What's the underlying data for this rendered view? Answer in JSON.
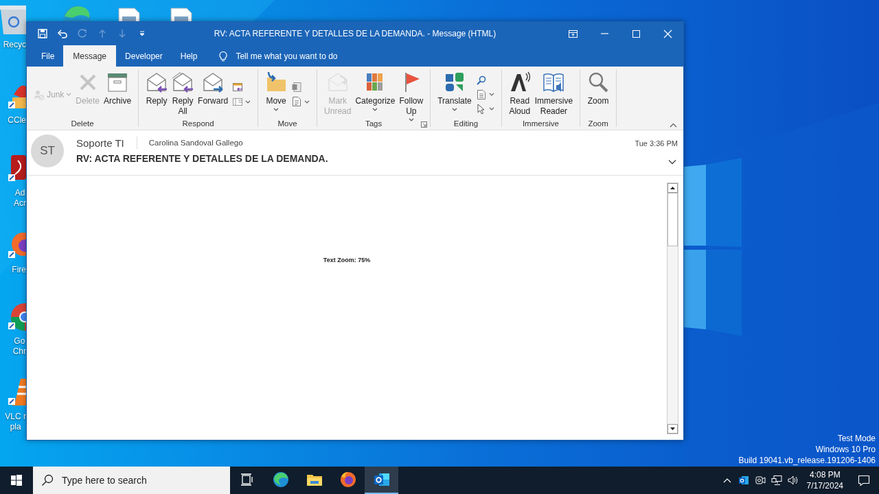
{
  "desktop": {
    "icons": [
      {
        "label": "Recyc"
      },
      {
        "label": "CCle"
      },
      {
        "label": "Ad\nAcr"
      },
      {
        "label": "Fire"
      },
      {
        "label": "Go\nChr"
      },
      {
        "label": "VLC r\npla"
      }
    ],
    "system_notice": [
      "Test Mode",
      "Windows 10 Pro",
      "Build 19041.vb_release.191206-1406"
    ]
  },
  "window": {
    "title": "RV: ACTA REFERENTE Y DETALLES DE LA DEMANDA.  -  Message (HTML)",
    "quick_access": [
      {
        "disabled": false
      },
      {
        "disabled": false
      },
      {
        "disabled": true
      },
      {
        "disabled": true
      },
      {
        "disabled": true
      },
      {
        "disabled": false
      }
    ],
    "tabs": [
      {
        "label": "File",
        "selected": false
      },
      {
        "label": "Message",
        "selected": true
      },
      {
        "label": "Developer",
        "selected": false
      },
      {
        "label": "Help",
        "selected": false
      }
    ],
    "tell_me": "Tell me what you want to do",
    "ribbon": {
      "groups": [
        {
          "label": "Delete",
          "launcher": false,
          "buttons": [
            {
              "kind": "small",
              "label": "Junk",
              "disabled": true,
              "dropdown": true
            },
            {
              "kind": "large",
              "label": "Delete",
              "disabled": true,
              "dropdown": false
            },
            {
              "kind": "large",
              "label": "Archive",
              "disabled": false,
              "dropdown": false
            }
          ]
        },
        {
          "label": "Respond",
          "launcher": false,
          "buttons": [
            {
              "kind": "large",
              "label": "Reply",
              "disabled": false,
              "dropdown": false
            },
            {
              "kind": "large",
              "label": "Reply\nAll",
              "disabled": false,
              "dropdown": false
            },
            {
              "kind": "large",
              "label": "Forward",
              "disabled": false,
              "dropdown": false
            },
            {
              "kind": "small",
              "disabled": false,
              "dropdown": false
            },
            {
              "kind": "small",
              "disabled": false,
              "dropdown": true
            }
          ]
        },
        {
          "label": "Move",
          "launcher": false,
          "buttons": [
            {
              "kind": "large",
              "label": "Move",
              "disabled": false,
              "dropdown": true
            },
            {
              "kind": "small",
              "disabled": false,
              "dropdown": false
            },
            {
              "kind": "small",
              "disabled": false,
              "dropdown": true
            }
          ]
        },
        {
          "label": "Tags",
          "launcher": true,
          "buttons": [
            {
              "kind": "large",
              "label": "Mark\nUnread",
              "disabled": true,
              "dropdown": false
            },
            {
              "kind": "large",
              "label": "Categorize",
              "disabled": false,
              "dropdown": true
            },
            {
              "kind": "large",
              "label": "Follow\nUp",
              "disabled": false,
              "dropdown": true
            }
          ]
        },
        {
          "label": "Editing",
          "launcher": false,
          "buttons": [
            {
              "kind": "large",
              "label": "Translate",
              "disabled": false,
              "dropdown": true
            },
            {
              "kind": "small",
              "disabled": false,
              "dropdown": false
            },
            {
              "kind": "small",
              "disabled": false,
              "dropdown": true
            },
            {
              "kind": "small",
              "disabled": false,
              "dropdown": true
            }
          ]
        },
        {
          "label": "Immersive",
          "launcher": false,
          "buttons": [
            {
              "kind": "large",
              "label": "Read\nAloud",
              "disabled": false,
              "dropdown": false
            },
            {
              "kind": "large",
              "label": "Immersive\nReader",
              "disabled": false,
              "dropdown": false
            }
          ]
        },
        {
          "label": "Zoom",
          "launcher": false,
          "buttons": [
            {
              "kind": "large",
              "label": "Zoom",
              "disabled": false,
              "dropdown": false
            }
          ]
        }
      ]
    },
    "message": {
      "avatar": "ST",
      "sender": "Soporte TI",
      "recipient": "Carolina Sandoval Gallego",
      "time": "Tue 3:36 PM",
      "subject": "RV: ACTA REFERENTE Y DETALLES DE LA DEMANDA."
    },
    "body": {
      "text": "Text Zoom: 75%"
    }
  },
  "taskbar": {
    "search": {
      "placeholder": "Type here to search"
    },
    "apps": [
      {
        "selected": false
      },
      {
        "selected": false
      },
      {
        "selected": false
      },
      {
        "selected": false
      },
      {
        "selected": true
      }
    ],
    "time": "4:08 PM",
    "date": "7/17/2024"
  }
}
